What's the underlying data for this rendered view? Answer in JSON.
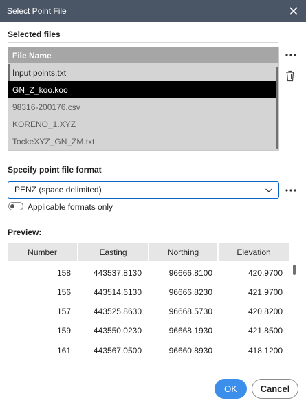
{
  "window": {
    "title": "Select Point File"
  },
  "selected_files": {
    "heading": "Selected files",
    "column_header": "File Name",
    "files": [
      "Input points.txt",
      "GN_Z_koo.koo",
      "98316-200176.csv",
      "KORENO_1.XYZ",
      "TockeXYZ_GN_ZM.txt"
    ]
  },
  "format": {
    "heading": "Specify point file format",
    "selected": "PENZ (space delimited)",
    "toggle_label": "Applicable formats only"
  },
  "preview": {
    "heading": "Preview:",
    "columns": [
      "Number",
      "Easting",
      "Northing",
      "Elevation"
    ],
    "rows": [
      [
        "158",
        "443537.8130",
        "96666.8100",
        "420.9700"
      ],
      [
        "156",
        "443514.6130",
        "96666.8230",
        "421.9700"
      ],
      [
        "157",
        "443525.8630",
        "96668.5730",
        "420.8200"
      ],
      [
        "159",
        "443550.0230",
        "96668.1930",
        "421.8500"
      ],
      [
        "161",
        "443567.0500",
        "96660.8930",
        "418.1200"
      ]
    ]
  },
  "buttons": {
    "ok": "OK",
    "cancel": "Cancel"
  }
}
